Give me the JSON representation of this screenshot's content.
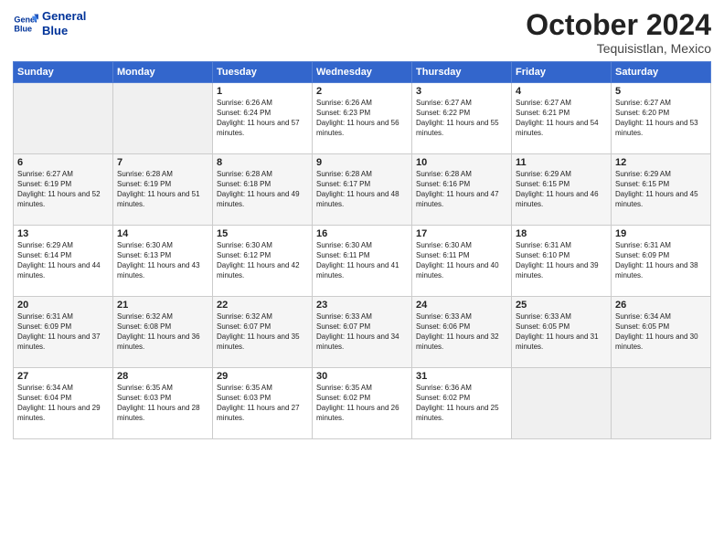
{
  "logo": {
    "line1": "General",
    "line2": "Blue"
  },
  "title": "October 2024",
  "location": "Tequisistlan, Mexico",
  "days_of_week": [
    "Sunday",
    "Monday",
    "Tuesday",
    "Wednesday",
    "Thursday",
    "Friday",
    "Saturday"
  ],
  "weeks": [
    [
      {
        "day": "",
        "empty": true
      },
      {
        "day": "",
        "empty": true
      },
      {
        "day": "1",
        "sunrise": "6:26 AM",
        "sunset": "6:24 PM",
        "daylight": "11 hours and 57 minutes."
      },
      {
        "day": "2",
        "sunrise": "6:26 AM",
        "sunset": "6:23 PM",
        "daylight": "11 hours and 56 minutes."
      },
      {
        "day": "3",
        "sunrise": "6:27 AM",
        "sunset": "6:22 PM",
        "daylight": "11 hours and 55 minutes."
      },
      {
        "day": "4",
        "sunrise": "6:27 AM",
        "sunset": "6:21 PM",
        "daylight": "11 hours and 54 minutes."
      },
      {
        "day": "5",
        "sunrise": "6:27 AM",
        "sunset": "6:20 PM",
        "daylight": "11 hours and 53 minutes."
      }
    ],
    [
      {
        "day": "6",
        "sunrise": "6:27 AM",
        "sunset": "6:19 PM",
        "daylight": "11 hours and 52 minutes."
      },
      {
        "day": "7",
        "sunrise": "6:28 AM",
        "sunset": "6:19 PM",
        "daylight": "11 hours and 51 minutes."
      },
      {
        "day": "8",
        "sunrise": "6:28 AM",
        "sunset": "6:18 PM",
        "daylight": "11 hours and 49 minutes."
      },
      {
        "day": "9",
        "sunrise": "6:28 AM",
        "sunset": "6:17 PM",
        "daylight": "11 hours and 48 minutes."
      },
      {
        "day": "10",
        "sunrise": "6:28 AM",
        "sunset": "6:16 PM",
        "daylight": "11 hours and 47 minutes."
      },
      {
        "day": "11",
        "sunrise": "6:29 AM",
        "sunset": "6:15 PM",
        "daylight": "11 hours and 46 minutes."
      },
      {
        "day": "12",
        "sunrise": "6:29 AM",
        "sunset": "6:15 PM",
        "daylight": "11 hours and 45 minutes."
      }
    ],
    [
      {
        "day": "13",
        "sunrise": "6:29 AM",
        "sunset": "6:14 PM",
        "daylight": "11 hours and 44 minutes."
      },
      {
        "day": "14",
        "sunrise": "6:30 AM",
        "sunset": "6:13 PM",
        "daylight": "11 hours and 43 minutes."
      },
      {
        "day": "15",
        "sunrise": "6:30 AM",
        "sunset": "6:12 PM",
        "daylight": "11 hours and 42 minutes."
      },
      {
        "day": "16",
        "sunrise": "6:30 AM",
        "sunset": "6:11 PM",
        "daylight": "11 hours and 41 minutes."
      },
      {
        "day": "17",
        "sunrise": "6:30 AM",
        "sunset": "6:11 PM",
        "daylight": "11 hours and 40 minutes."
      },
      {
        "day": "18",
        "sunrise": "6:31 AM",
        "sunset": "6:10 PM",
        "daylight": "11 hours and 39 minutes."
      },
      {
        "day": "19",
        "sunrise": "6:31 AM",
        "sunset": "6:09 PM",
        "daylight": "11 hours and 38 minutes."
      }
    ],
    [
      {
        "day": "20",
        "sunrise": "6:31 AM",
        "sunset": "6:09 PM",
        "daylight": "11 hours and 37 minutes."
      },
      {
        "day": "21",
        "sunrise": "6:32 AM",
        "sunset": "6:08 PM",
        "daylight": "11 hours and 36 minutes."
      },
      {
        "day": "22",
        "sunrise": "6:32 AM",
        "sunset": "6:07 PM",
        "daylight": "11 hours and 35 minutes."
      },
      {
        "day": "23",
        "sunrise": "6:33 AM",
        "sunset": "6:07 PM",
        "daylight": "11 hours and 34 minutes."
      },
      {
        "day": "24",
        "sunrise": "6:33 AM",
        "sunset": "6:06 PM",
        "daylight": "11 hours and 32 minutes."
      },
      {
        "day": "25",
        "sunrise": "6:33 AM",
        "sunset": "6:05 PM",
        "daylight": "11 hours and 31 minutes."
      },
      {
        "day": "26",
        "sunrise": "6:34 AM",
        "sunset": "6:05 PM",
        "daylight": "11 hours and 30 minutes."
      }
    ],
    [
      {
        "day": "27",
        "sunrise": "6:34 AM",
        "sunset": "6:04 PM",
        "daylight": "11 hours and 29 minutes."
      },
      {
        "day": "28",
        "sunrise": "6:35 AM",
        "sunset": "6:03 PM",
        "daylight": "11 hours and 28 minutes."
      },
      {
        "day": "29",
        "sunrise": "6:35 AM",
        "sunset": "6:03 PM",
        "daylight": "11 hours and 27 minutes."
      },
      {
        "day": "30",
        "sunrise": "6:35 AM",
        "sunset": "6:02 PM",
        "daylight": "11 hours and 26 minutes."
      },
      {
        "day": "31",
        "sunrise": "6:36 AM",
        "sunset": "6:02 PM",
        "daylight": "11 hours and 25 minutes."
      },
      {
        "day": "",
        "empty": true
      },
      {
        "day": "",
        "empty": true
      }
    ]
  ]
}
